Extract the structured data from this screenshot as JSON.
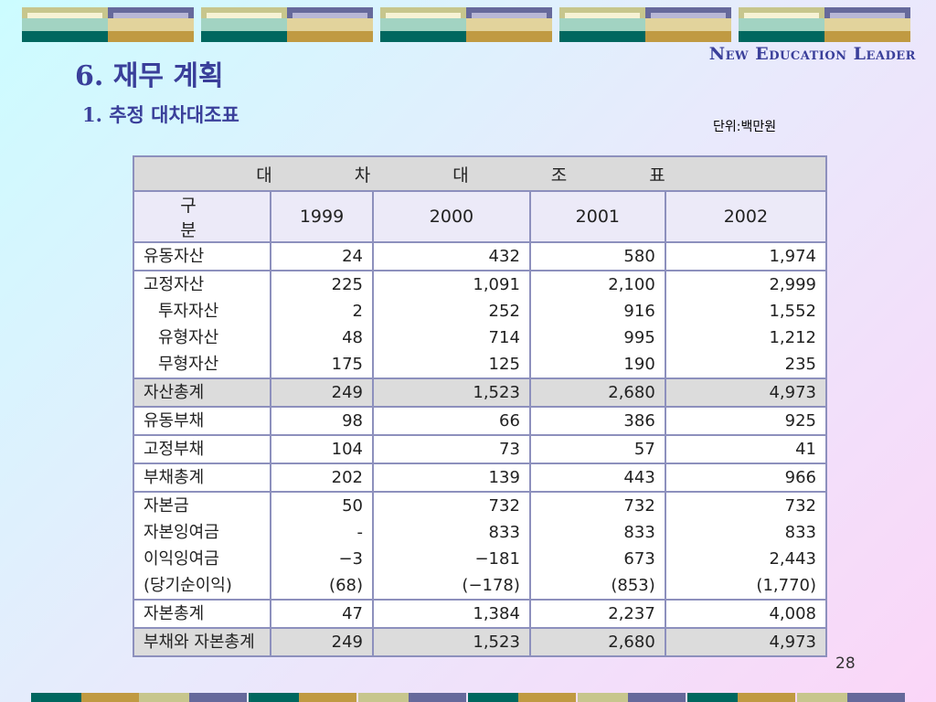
{
  "header": {
    "brand": "New Education Leader",
    "title": "6. 재무 계획",
    "subtitle": "1. 추정 대차대조표",
    "unit": "단위:백만원"
  },
  "table": {
    "title": "대 차 대 조 표",
    "col_header": "구 분",
    "years": [
      "1999",
      "2000",
      "2001",
      "2002"
    ],
    "rows": [
      {
        "style": "white",
        "labels": [
          "유동자산"
        ],
        "values": [
          [
            "24"
          ],
          [
            "432"
          ],
          [
            "580"
          ],
          [
            "1,974"
          ]
        ]
      },
      {
        "style": "white",
        "labels": [
          "고정자산",
          "투자자산",
          "유형자산",
          "무형자산"
        ],
        "indent": [
          false,
          true,
          true,
          true
        ],
        "values": [
          [
            "225",
            "2",
            "48",
            "175"
          ],
          [
            "1,091",
            "252",
            "714",
            "125"
          ],
          [
            "2,100",
            "916",
            "995",
            "190"
          ],
          [
            "2,999",
            "1,552",
            "1,212",
            "235"
          ]
        ]
      },
      {
        "style": "gray",
        "labels": [
          "자산총계"
        ],
        "values": [
          [
            "249"
          ],
          [
            "1,523"
          ],
          [
            "2,680"
          ],
          [
            "4,973"
          ]
        ]
      },
      {
        "style": "white",
        "labels": [
          "유동부채"
        ],
        "values": [
          [
            "98"
          ],
          [
            "66"
          ],
          [
            "386"
          ],
          [
            "925"
          ]
        ]
      },
      {
        "style": "white",
        "labels": [
          "고정부채"
        ],
        "values": [
          [
            "104"
          ],
          [
            "73"
          ],
          [
            "57"
          ],
          [
            "41"
          ]
        ]
      },
      {
        "style": "white",
        "labels": [
          "부채총계"
        ],
        "values": [
          [
            "202"
          ],
          [
            "139"
          ],
          [
            "443"
          ],
          [
            "966"
          ]
        ]
      },
      {
        "style": "white",
        "labels": [
          "자본금",
          "자본잉여금",
          "이익잉여금",
          "(당기순이익)"
        ],
        "indent": [
          false,
          false,
          false,
          false
        ],
        "values": [
          [
            "50",
            "-",
            "−3",
            "(68)"
          ],
          [
            "732",
            "833",
            "−181",
            "(−178)"
          ],
          [
            "732",
            "833",
            "673",
            "(853)"
          ],
          [
            "732",
            "833",
            "2,443",
            "(1,770)"
          ]
        ]
      },
      {
        "style": "white",
        "labels": [
          "자본총계"
        ],
        "values": [
          [
            "47"
          ],
          [
            "1,384"
          ],
          [
            "2,237"
          ],
          [
            "4,008"
          ]
        ]
      },
      {
        "style": "gray",
        "labels": [
          "부채와 자본총계"
        ],
        "values": [
          [
            "249"
          ],
          [
            "1,523"
          ],
          [
            "2,680"
          ],
          [
            "4,973"
          ]
        ]
      }
    ]
  },
  "footer": {
    "page_number": "28"
  },
  "colors": {
    "accent": "#3a3f9a",
    "table_border": "#8d90bd",
    "total_row_bg": "#dcdcdc"
  }
}
